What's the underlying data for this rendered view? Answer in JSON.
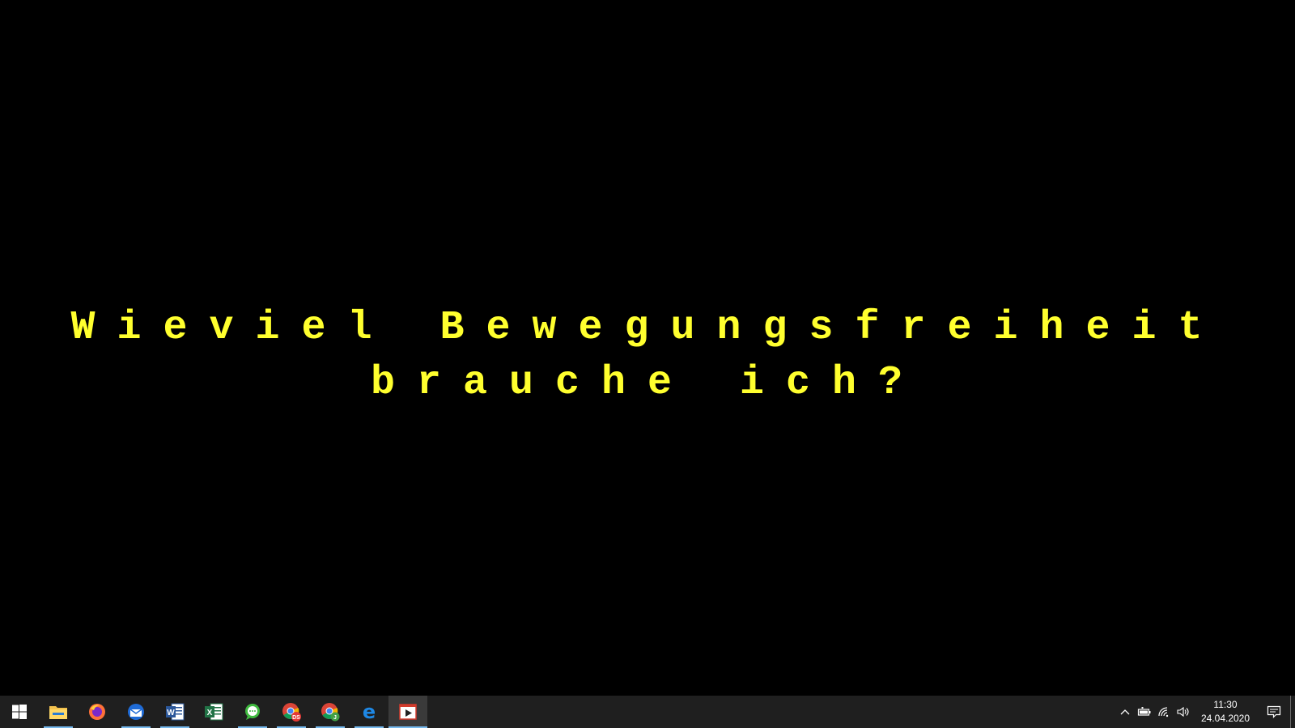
{
  "slide": {
    "caption_lines": [
      "Wieviel Bewegungsfreiheit",
      "brauche ich?"
    ],
    "text_color": "#ffff2e",
    "background": "#000000"
  },
  "taskbar": {
    "start_icon": "windows-logo-icon",
    "apps": [
      {
        "icon": "file-explorer-icon",
        "running": true,
        "active": false
      },
      {
        "icon": "firefox-icon",
        "running": false,
        "active": false
      },
      {
        "icon": "thunderbird-icon",
        "running": true,
        "active": false
      },
      {
        "icon": "word-icon",
        "running": true,
        "active": false
      },
      {
        "icon": "excel-icon",
        "running": false,
        "active": false
      },
      {
        "icon": "chat-icon",
        "running": true,
        "active": false
      },
      {
        "icon": "chrome-profile-red-icon",
        "running": true,
        "active": false
      },
      {
        "icon": "chrome-profile-green-icon",
        "running": true,
        "active": false
      },
      {
        "icon": "edge-icon",
        "running": true,
        "active": false
      },
      {
        "icon": "video-player-icon",
        "running": true,
        "active": true
      }
    ],
    "tray": {
      "icons": [
        "chevron-up-icon",
        "battery-icon",
        "wifi-icon",
        "volume-icon"
      ],
      "time": "11:30",
      "date": "24.04.2020",
      "notification_icon": "action-center-icon"
    }
  }
}
